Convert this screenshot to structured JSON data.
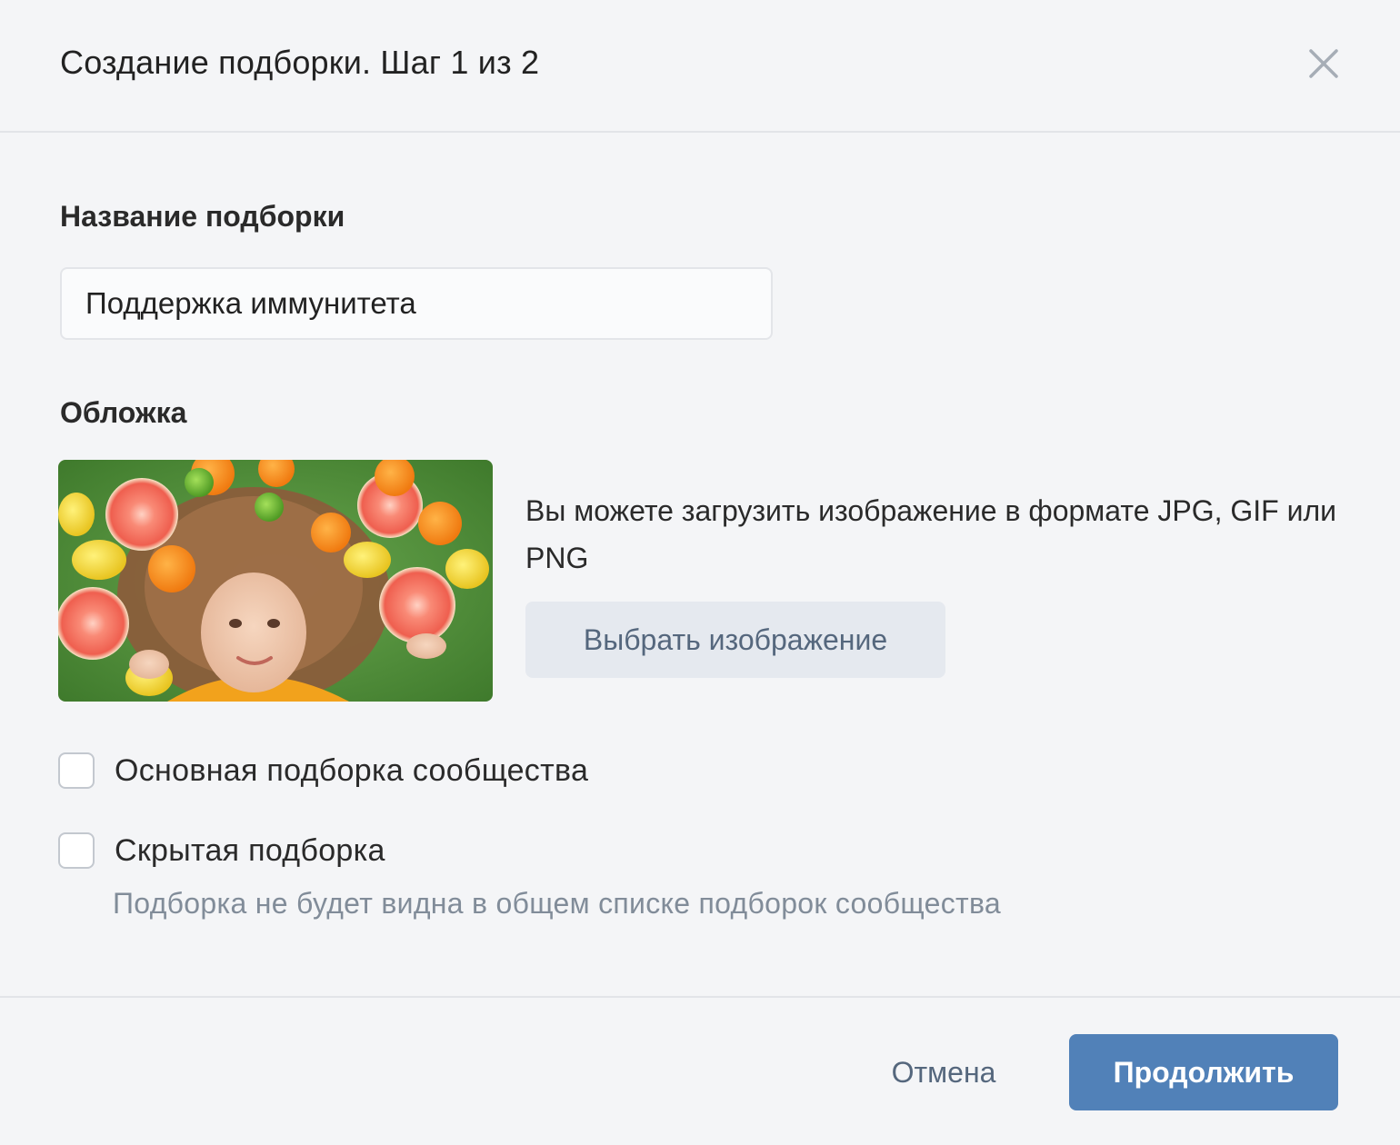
{
  "dialog": {
    "title": "Создание подборки. Шаг 1 из 2",
    "close_icon": "close-icon"
  },
  "name_field": {
    "label": "Название подборки",
    "value": "Поддержка иммунитета",
    "placeholder": ""
  },
  "cover": {
    "label": "Обложка",
    "image_description_icon": "cover-photo",
    "hint": "Вы можете загрузить изображение в формате JPG, GIF или PNG",
    "choose_button": "Выбрать изображение"
  },
  "options": {
    "main_collection": {
      "label": "Основная подборка сообщества",
      "checked": false
    },
    "hidden_collection": {
      "label": "Скрытая подборка",
      "checked": false,
      "description": "Подборка не будет видна в общем списке подборок сообщества"
    }
  },
  "footer": {
    "cancel_label": "Отмена",
    "continue_label": "Продолжить"
  },
  "colors": {
    "background": "#f4f5f7",
    "primary_button": "#5181b8",
    "secondary_button": "#e5e9ef",
    "muted_text": "#818c99"
  }
}
